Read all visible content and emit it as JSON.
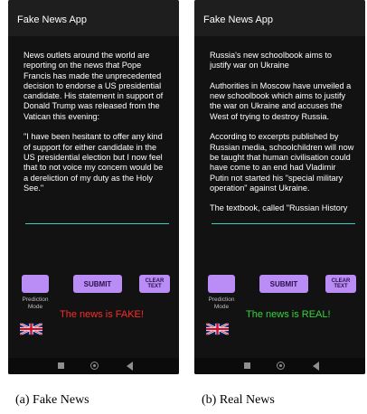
{
  "phones": [
    {
      "app_title": "Fake News App",
      "news_text": "News outlets around the world are reporting on the news that Pope Francis has made the unprecedented decision to endorse a US presidential candidate. His statement in support of Donald Trump was released from the Vatican this evening:\n\n\"I have been hesitant to offer any kind of support for either candidate in the US presidential election but I now feel that to not voice my concern would be a dereliction of my duty as the Holy See.\"",
      "submit_label": "SUBMIT",
      "clear_label": "CLEAR\nTEXT",
      "mode_label": "Prediction\nMode",
      "result_text": "The news is FAKE!",
      "result_color": "#ff2a2a",
      "flag_icon": "uk-flag-icon"
    },
    {
      "app_title": "Fake News App",
      "news_text": "Russia's new schoolbook aims to justify war on Ukraine\n\nAuthorities in Moscow have unveiled a new schoolbook which aims to justify the war on Ukraine and accuses the West of trying to destroy Russia.\n\nAccording to excerpts published by Russian media, schoolchildren will now be taught that human civilisation could have come to an end had Vladimir Putin not started his \"special military operation\" against Ukraine.\n\nThe textbook, called \"Russian History",
      "submit_label": "SUBMIT",
      "clear_label": "CLEAR\nTEXT",
      "mode_label": "Prediction\nMode",
      "result_text": "The news is REAL!",
      "result_color": "#35d53a",
      "flag_icon": "uk-flag-icon"
    }
  ],
  "captions": [
    "(a) Fake News",
    "(b) Real News"
  ],
  "colors": {
    "button": "#b98cf6",
    "input_underline": "#35d0c0",
    "background": "#121212"
  }
}
